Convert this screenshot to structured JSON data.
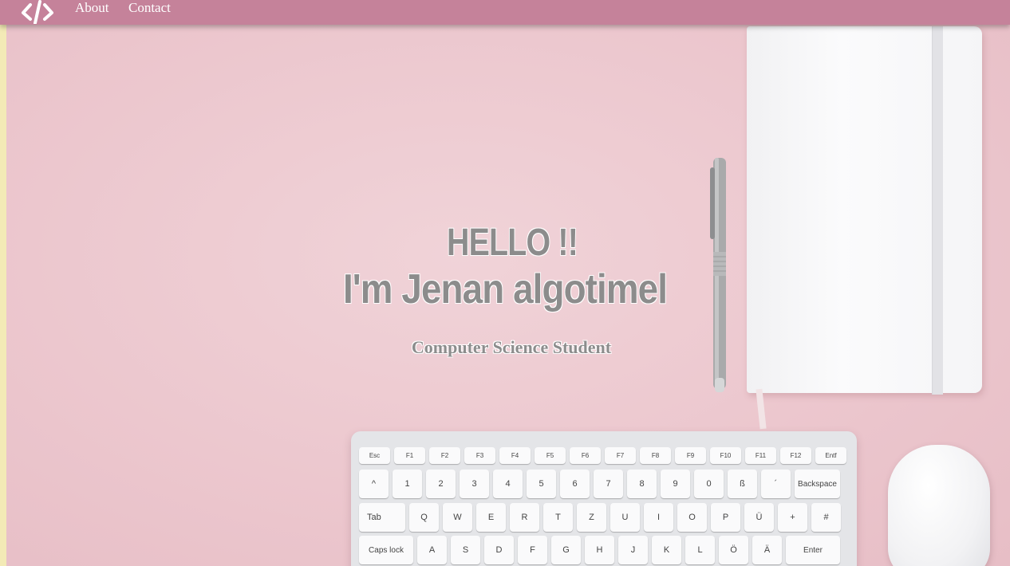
{
  "nav": {
    "logo_icon": "code-brackets-icon",
    "links": [
      "About",
      "Contact"
    ]
  },
  "hero": {
    "greeting": "HELLO !!",
    "name": "I'm Jenan algotimel",
    "subtitle": "Computer Science Student"
  },
  "keyboard": {
    "fn_row": [
      "Esc",
      "F1",
      "F2",
      "F3",
      "F4",
      "F5",
      "F6",
      "F7",
      "F8",
      "F9",
      "F10",
      "F11",
      "F12",
      "Entf"
    ],
    "row1": [
      "^",
      "1",
      "2",
      "3",
      "4",
      "5",
      "6",
      "7",
      "8",
      "9",
      "0",
      "ß",
      "´",
      "Backspace"
    ],
    "row2": [
      "Tab",
      "Q",
      "W",
      "E",
      "R",
      "T",
      "Z",
      "U",
      "I",
      "O",
      "P",
      "Ü",
      "+",
      "#"
    ],
    "row3": [
      "Caps lock",
      "A",
      "S",
      "D",
      "F",
      "G",
      "H",
      "J",
      "K",
      "L",
      "Ö",
      "Ä",
      "Enter"
    ]
  },
  "colors": {
    "navbar": "#c5829a",
    "background": "#ecc9cf",
    "text_gray": "#8c8c8c"
  }
}
